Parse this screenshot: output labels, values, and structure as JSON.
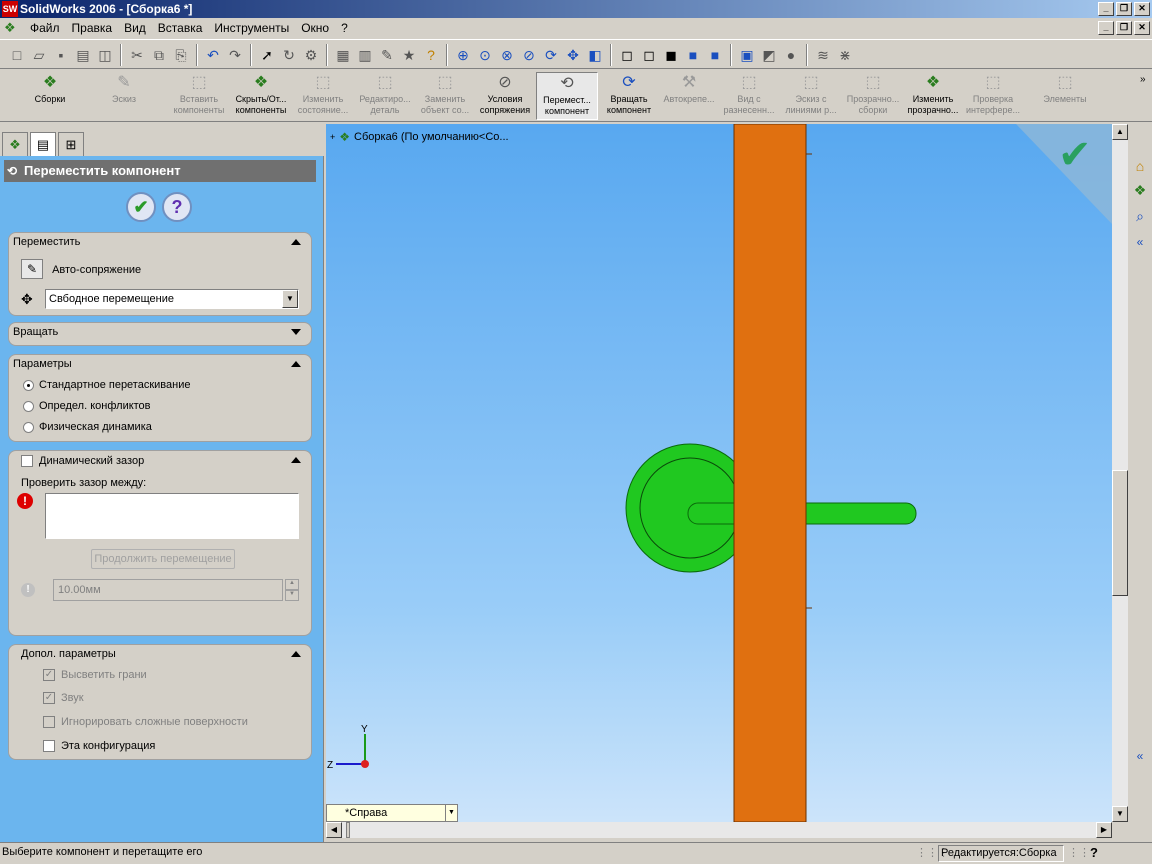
{
  "window": {
    "title": "SolidWorks 2006 - [Сборка6 *]"
  },
  "menu": {
    "items": [
      "Файл",
      "Правка",
      "Вид",
      "Вставка",
      "Инструменты",
      "Окно",
      "?"
    ]
  },
  "command_manager": {
    "items": [
      {
        "label": "Сборки",
        "state": "active"
      },
      {
        "label": "Эскиз",
        "state": "disabled"
      },
      {
        "label": "Вставить компоненты",
        "state": "disabled"
      },
      {
        "label": "Скрыть/От... компоненты",
        "state": "active"
      },
      {
        "label": "Изменить состояние...",
        "state": "disabled"
      },
      {
        "label": "Редактиро... деталь",
        "state": "disabled"
      },
      {
        "label": "Заменить объект со...",
        "state": "disabled"
      },
      {
        "label": "Условия сопряжения",
        "state": "active"
      },
      {
        "label": "Перемест... компонент",
        "state": "pressed"
      },
      {
        "label": "Вращать компонент",
        "state": "active"
      },
      {
        "label": "Автокрепе...",
        "state": "disabled"
      },
      {
        "label": "Вид с разнесенн...",
        "state": "disabled"
      },
      {
        "label": "Эскиз с линиями р...",
        "state": "disabled"
      },
      {
        "label": "Прозрачно... сборки",
        "state": "disabled"
      },
      {
        "label": "Изменить прозрачно...",
        "state": "active"
      },
      {
        "label": "Проверка интерфере...",
        "state": "disabled"
      },
      {
        "label": "Элементы",
        "state": "disabled"
      }
    ]
  },
  "property_manager": {
    "title": "Переместить компонент",
    "move": {
      "header": "Переместить",
      "auto_mate": "Авто-сопряжение",
      "move_type": "Свбодное перемещение"
    },
    "rotate": {
      "header": "Вращать"
    },
    "options": {
      "header": "Параметры",
      "radios": [
        {
          "label": "Стандартное перетаскивание",
          "checked": true
        },
        {
          "label": "Определ. конфликтов",
          "checked": false
        },
        {
          "label": "Физическая динамика",
          "checked": false
        }
      ]
    },
    "clearance": {
      "header": "Динамический зазор",
      "check_between": "Проверить зазор между:",
      "continue_btn": "Продолжить перемещение",
      "value": "10.00мм"
    },
    "advanced": {
      "header": "Допол. параметры",
      "checks": [
        {
          "label": "Высветить грани",
          "checked": true,
          "enabled": false
        },
        {
          "label": "Звук",
          "checked": true,
          "enabled": false
        },
        {
          "label": "Игнорировать сложные поверхности",
          "checked": false,
          "enabled": false
        },
        {
          "label": "Эта конфигурация",
          "checked": false,
          "enabled": true
        }
      ]
    }
  },
  "tree": {
    "root": "Сборка6  (По умолчанию<Со..."
  },
  "viewport": {
    "view_name": "*Справа",
    "axis_y": "Y",
    "axis_z": "Z",
    "colors": {
      "plate": "#e07010",
      "part": "#20c820"
    }
  },
  "status": {
    "message": "Выберите компонент и перетащите его",
    "mode": "Редактируется:Сборка",
    "help": "?"
  }
}
